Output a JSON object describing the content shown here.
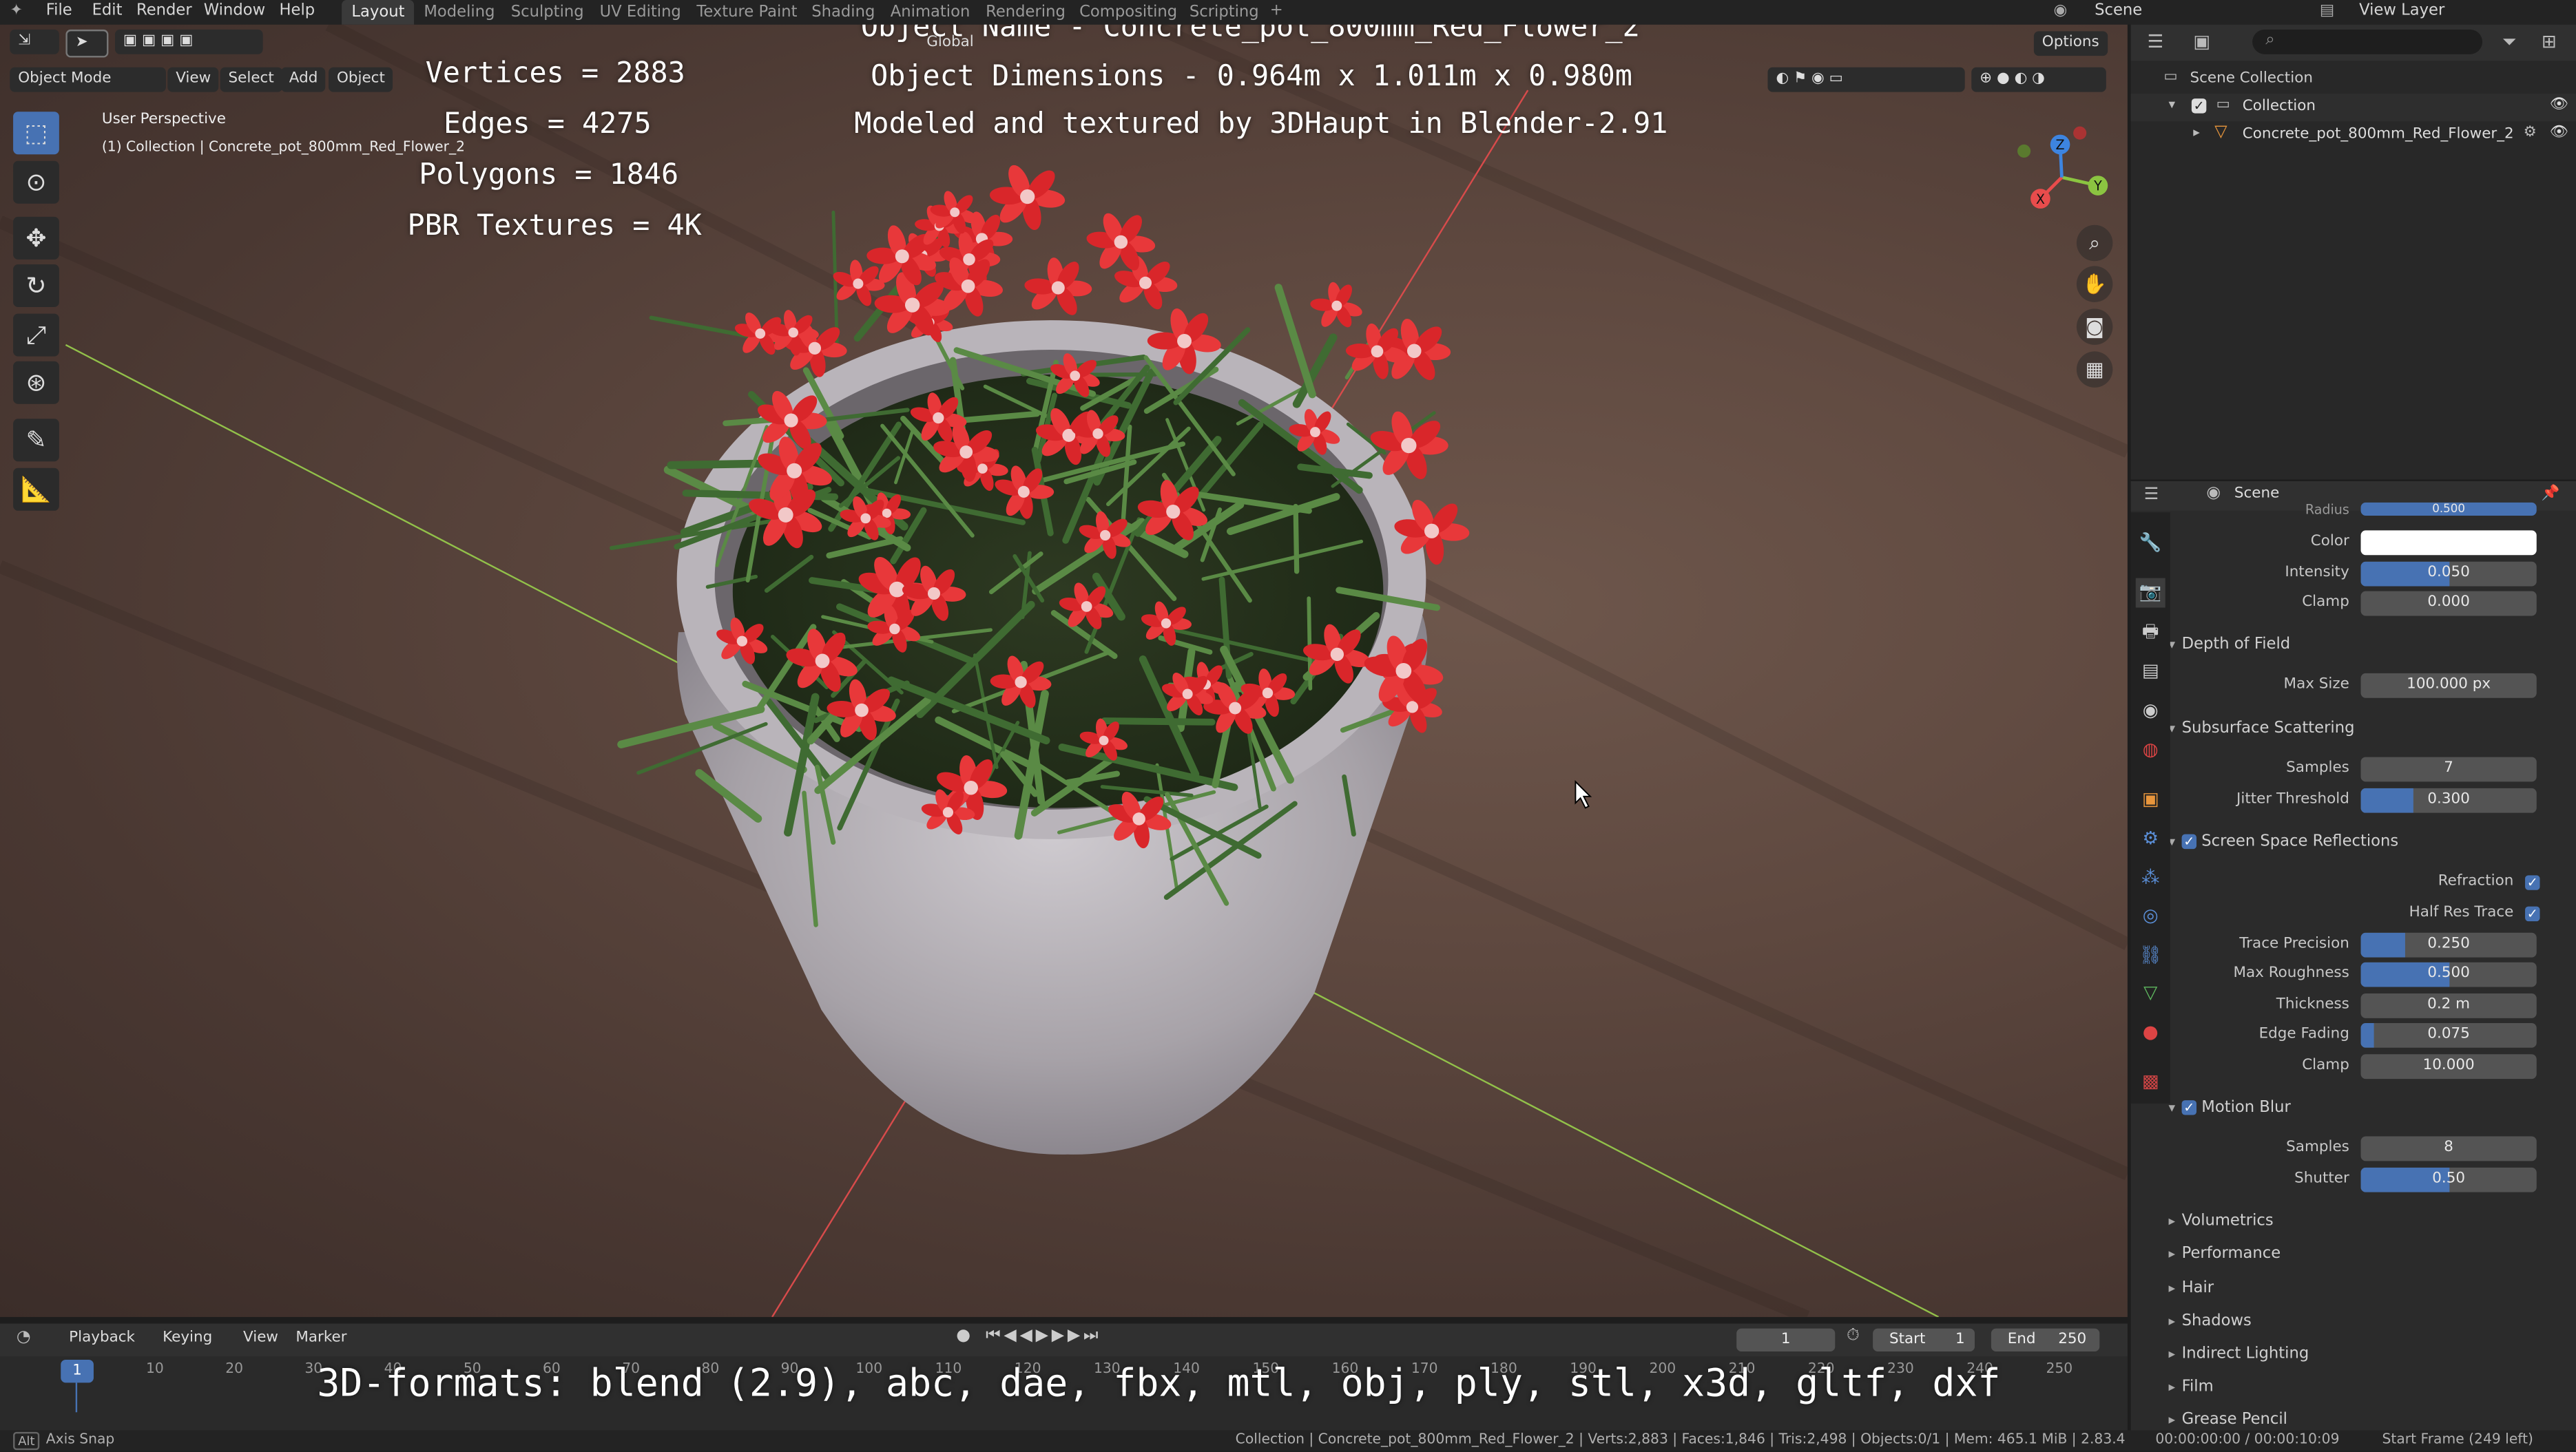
{
  "top_menu": {
    "items": [
      "File",
      "Edit",
      "Render",
      "Window",
      "Help"
    ],
    "workspaces": [
      "Layout",
      "Modeling",
      "Sculpting",
      "UV Editing",
      "Texture Paint",
      "Shading",
      "Animation",
      "Rendering",
      "Compositing",
      "Scripting"
    ],
    "active_workspace": "Layout",
    "scene_label": "Scene",
    "view_layer_label": "View Layer"
  },
  "viewport_header": {
    "mode": "Object Mode",
    "menus": [
      "View",
      "Select",
      "Add",
      "Object"
    ],
    "transform_orientation": "Global",
    "options": "Options"
  },
  "viewport_info": {
    "perspective": "User Perspective",
    "collection_path": "(1) Collection | Concrete_pot_800mm_Red_Flower_2"
  },
  "overlay_text": {
    "vertices": "Vertices = 2883",
    "edges": "Edges = 4275",
    "polygons": "Polygons = 1846",
    "pbr": "PBR Textures = 4K",
    "object_name": "Object Name - Concrete_pot_800mm_Red_Flower_2",
    "object_dimensions": "Object Dimensions -  0.964m x 1.011m x 0.980m",
    "modeled_by": "Modeled and textured by 3DHaupt in Blender-2.91",
    "formats": "3D-formats: blend (2.9), abc, dae, fbx, mtl, obj, ply, stl, x3d, gltf, dxf"
  },
  "gizmo_axes": {
    "x": "X",
    "y": "Y",
    "z": "Z"
  },
  "outliner": {
    "root": "Scene Collection",
    "collection": "Collection",
    "object": "Concrete_pot_800mm_Red_Flower_2"
  },
  "properties": {
    "context": "Scene",
    "cut_label": "Radius",
    "cut_value": "0.500",
    "color_label": "Color",
    "color_value": "#ffffff",
    "intensity": {
      "label": "Intensity",
      "value": "0.050",
      "fraction": 0.5
    },
    "clamp_top": {
      "label": "Clamp",
      "value": "0.000"
    },
    "dof": {
      "title": "Depth of Field",
      "max_size_label": "Max Size",
      "max_size": "100.000 px"
    },
    "sss": {
      "title": "Subsurface Scattering",
      "samples_label": "Samples",
      "samples": "7",
      "jitter_label": "Jitter Threshold",
      "jitter": "0.300",
      "jitter_fraction": 0.3
    },
    "ssr": {
      "title": "Screen Space Reflections",
      "refraction": "Refraction",
      "half_res": "Half Res Trace",
      "trace_precision": {
        "label": "Trace Precision",
        "value": "0.250",
        "fraction": 0.25
      },
      "max_roughness": {
        "label": "Max Roughness",
        "value": "0.500",
        "fraction": 0.5
      },
      "thickness": {
        "label": "Thickness",
        "value": "0.2 m"
      },
      "edge_fading": {
        "label": "Edge Fading",
        "value": "0.075",
        "fraction": 0.075
      },
      "clamp": {
        "label": "Clamp",
        "value": "10.000"
      }
    },
    "motion_blur": {
      "title": "Motion Blur",
      "samples_label": "Samples",
      "samples": "8",
      "shutter_label": "Shutter",
      "shutter": "0.50",
      "shutter_fraction": 0.5
    },
    "collapsed_panels": [
      "Volumetrics",
      "Performance",
      "Hair",
      "Shadows",
      "Indirect Lighting",
      "Film",
      "Grease Pencil"
    ]
  },
  "timeline": {
    "menus": [
      "Playback",
      "Keying",
      "View",
      "Marker"
    ],
    "current_frame": "1",
    "start_label": "Start",
    "start": "1",
    "end_label": "End",
    "end": "250",
    "ruler": [
      "10",
      "20",
      "30",
      "40",
      "50",
      "60",
      "70",
      "80",
      "90",
      "100",
      "110",
      "120",
      "130",
      "140",
      "150",
      "160",
      "170",
      "180",
      "190",
      "200",
      "210",
      "220",
      "230",
      "240",
      "250"
    ]
  },
  "statusbar": {
    "left_key": "Alt",
    "left": "Axis Snap",
    "center": "Collection | Concrete_pot_800mm_Red_Flower_2 | Verts:2,883 | Faces:1,846 | Tris:2,498 | Objects:0/1 | Mem: 465.1 MiB | 2.83.4",
    "time": "00:00:00:00 / 00:00:10:09",
    "start_frame": "Start Frame (249 left)"
  },
  "colors": {
    "accent": "#4772b3",
    "x_axis": "#e84c4c",
    "y_axis": "#8bc441",
    "z_axis": "#3d84e0"
  }
}
